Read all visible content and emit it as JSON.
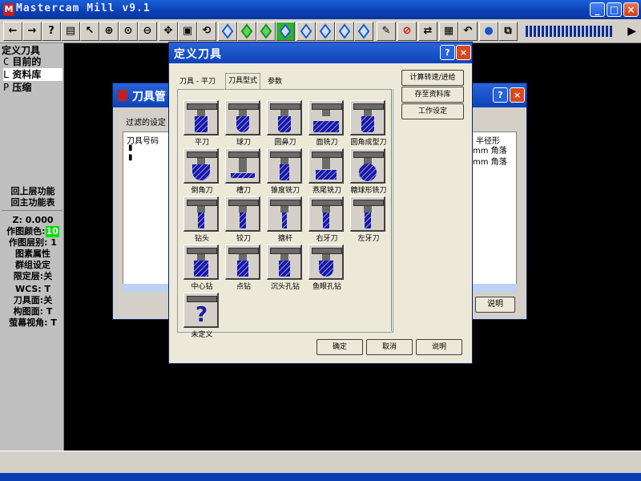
{
  "app": {
    "title": "Mastercam Mill v9.1",
    "icon": "mastercam-logo"
  },
  "toolbar": {
    "buttons": [
      {
        "name": "back-arrow",
        "glyph": "←"
      },
      {
        "name": "forward-arrow",
        "glyph": "→"
      },
      {
        "name": "help",
        "glyph": "?"
      },
      {
        "name": "calculator",
        "glyph": "▤"
      },
      {
        "name": "query",
        "glyph": "↖?"
      },
      {
        "name": "zoom-in",
        "glyph": "⊕"
      },
      {
        "name": "zoom-window",
        "glyph": "⊙"
      },
      {
        "name": "zoom-out",
        "glyph": "⊖"
      },
      {
        "name": "pan",
        "glyph": "✥"
      },
      {
        "name": "zoom-box",
        "glyph": "▣"
      },
      {
        "name": "rotate",
        "glyph": "⟲"
      }
    ]
  },
  "side": {
    "menu_title": "定义刀具",
    "items": [
      {
        "key": "C",
        "label": "目前的"
      },
      {
        "key": "L",
        "label": "资料库"
      },
      {
        "key": "P",
        "label": "压缩"
      }
    ],
    "nav": [
      "回上层功能",
      "回主功能表"
    ],
    "z_label": "Z:  0.000",
    "color_label": "作图颜色:",
    "color_value": "10",
    "level_label": "作图层别: 1",
    "attr_label": "图素属性",
    "group_label": "群组设定",
    "limit_label": "限定层:关",
    "wcs_label": "WCS:  T",
    "toolplane_label": "刀具面:关",
    "cplane_label": "构图面:  T",
    "gview_label": "萤幕视角:  T"
  },
  "bg_dialog": {
    "title": "刀具管",
    "filter_label": "过滤的设定",
    "col1_header": "刀具号码",
    "col2_header": "半径形",
    "rows_right": [
      "角落",
      "角落"
    ],
    "explain_label": "说明"
  },
  "dialog": {
    "title": "定义刀具",
    "tabs": [
      "刀具 - 平刀",
      "刀具型式",
      "参数"
    ],
    "tools": [
      {
        "label": "平刀"
      },
      {
        "label": "球刀"
      },
      {
        "label": "圆鼻刀"
      },
      {
        "label": "面铣刀"
      },
      {
        "label": "圆角成型刀"
      },
      {
        "label": "倒角刀"
      },
      {
        "label": "槽刀"
      },
      {
        "label": "锥度铣刀"
      },
      {
        "label": "燕尾铣刀"
      },
      {
        "label": "糖球形铣刀"
      },
      {
        "label": "钻头"
      },
      {
        "label": "铰刀"
      },
      {
        "label": "搪杆"
      },
      {
        "label": "右牙刀"
      },
      {
        "label": "左牙刀"
      },
      {
        "label": "中心钻"
      },
      {
        "label": "点钻"
      },
      {
        "label": "沉头孔钻"
      },
      {
        "label": "鱼眼孔钻"
      },
      {
        "label": "未定义"
      }
    ],
    "right_buttons": [
      "计算转速/进给",
      "存至资料库",
      "工作设定"
    ],
    "ok_label": "确定",
    "cancel_label": "取消",
    "help_label": "说明"
  }
}
